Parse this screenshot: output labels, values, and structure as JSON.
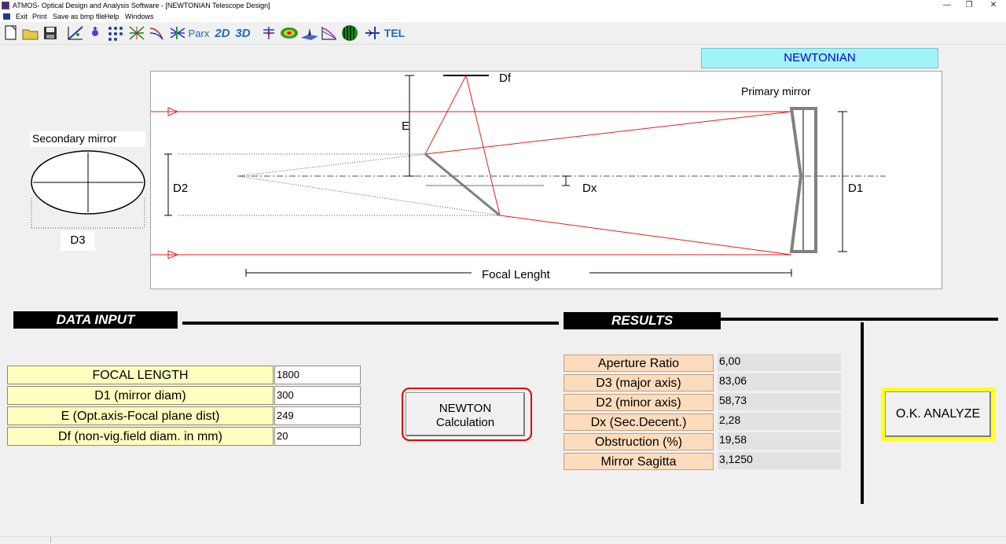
{
  "window": {
    "title": "ATMOS- Optical Design and Analysis Software - [NEWTONIAN Telescope Design]",
    "controls": {
      "minimize": "—",
      "restore": "❐",
      "close": "✕"
    }
  },
  "menu": [
    "Exit",
    "Print",
    "Save as bmp file",
    "Help",
    "Windows"
  ],
  "toolbar": {
    "icons": [
      "new-file-icon",
      "open-folder-icon",
      "save-disk-icon",
      "optical-layout-icon",
      "spot-drop-icon",
      "spot-diagram-icon",
      "ray-fan-icon",
      "aberration-curve-icon",
      "field-rays-icon",
      "2d-view",
      "3d-view",
      "zernike-icon",
      "wavefront-map-icon",
      "psf-3d-icon",
      "mtf-icon",
      "interferogram-icon",
      "telescope-icon"
    ],
    "parax": "Parx",
    "view2d": "2D",
    "view3d": "3D",
    "tel": "TEL"
  },
  "design": {
    "model": "NEWTONIAN"
  },
  "diagram": {
    "labels": {
      "df": "Df",
      "e": "E",
      "primary": "Primary mirror",
      "secondary": "Secondary mirror",
      "d2": "D2",
      "d1": "D1",
      "d3": "D3",
      "dx": "Dx",
      "focal": "Focal Lenght"
    },
    "colors": {
      "ray": "#e02020",
      "mirror": "#808080"
    }
  },
  "data_input": {
    "header": "DATA INPUT",
    "rows": [
      {
        "label": "FOCAL LENGTH",
        "value": "1800"
      },
      {
        "label": "D1  (mirror diam)",
        "value": "300"
      },
      {
        "label": "E (Opt.axis-Focal plane dist)",
        "value": "249"
      },
      {
        "label": "Df  (non-vig.field diam. in mm)",
        "value": "20"
      }
    ]
  },
  "buttons": {
    "newton_line1": "NEWTON",
    "newton_line2": "Calculation",
    "ok_analyze": "O.K.  ANALYZE"
  },
  "results": {
    "header": "RESULTS",
    "rows": [
      {
        "label": "Aperture Ratio",
        "value": "6,00"
      },
      {
        "label": "D3 (major axis)",
        "value": "83,06"
      },
      {
        "label": "D2 (minor axis)",
        "value": "58,73"
      },
      {
        "label": "Dx (Sec.Decent.)",
        "value": "2,28"
      },
      {
        "label": "Obstruction  (%)",
        "value": "19,58"
      },
      {
        "label": "Mirror Sagitta",
        "value": "3,1250"
      }
    ]
  }
}
